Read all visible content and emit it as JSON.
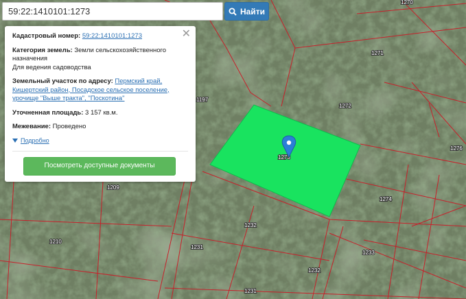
{
  "search": {
    "value": "59:22:1410101:1273",
    "button_label": "Найти"
  },
  "info": {
    "cadastral_label": "Кадастровый номер:",
    "cadastral_value": "59:22:1410101:1273",
    "category_label": "Категория земель:",
    "category_value": "Земли сельскохозяйственного назначения",
    "purpose_value": "Для ведения садоводства",
    "address_label": "Земельный участок по адресу:",
    "address_value": "Пермский край, Кишертский район, Посадское сельское поселение, урочище \"Выше тракта\", \"Поскотина\"",
    "area_label": "Уточненная площадь:",
    "area_value": "3 157 кв.м.",
    "survey_label": "Межевание:",
    "survey_value": "Проведено",
    "more_link": "Подробно",
    "docs_button": "Посмотреть доступные документы"
  },
  "map": {
    "selected_parcel": "1273",
    "parcel_labels": [
      "1270",
      "1271",
      "1272",
      "1276",
      "1274",
      "1209",
      "1232",
      "1210",
      "1231",
      "1233",
      "1232",
      "1231",
      "1197"
    ],
    "colors": {
      "selected_fill": "#19e35f",
      "boundary": "#c8202a",
      "marker": "#2b7fd6",
      "search_button": "#337ab7",
      "docs_button": "#5cb85c"
    }
  }
}
